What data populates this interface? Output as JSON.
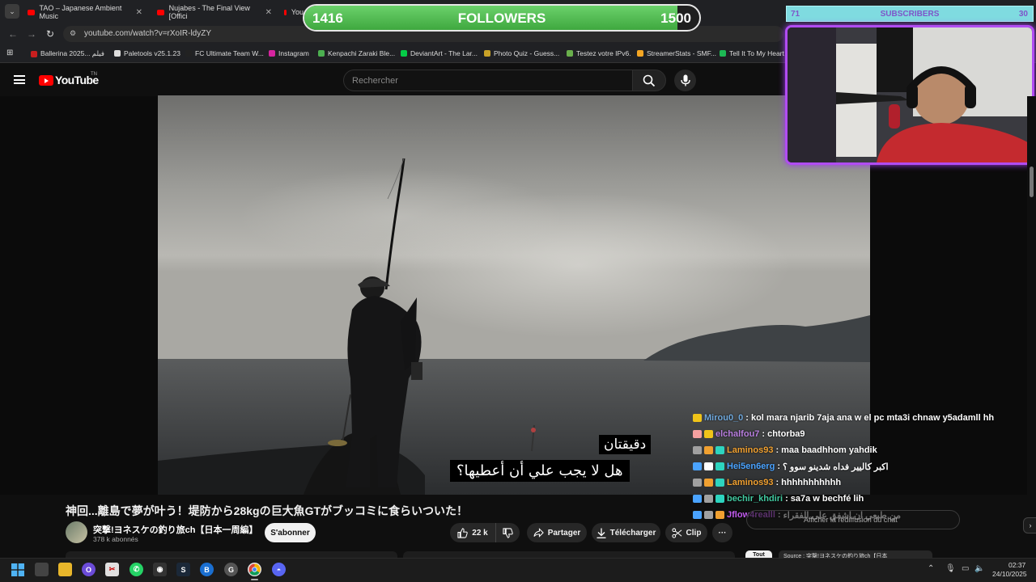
{
  "browser": {
    "tabs": [
      {
        "title": "TAO – Japanese Ambient Music"
      },
      {
        "title": "Nujabes - The Final View [Offici"
      },
      {
        "title": "You"
      }
    ],
    "address": {
      "url": "youtube.com/watch?v=rXoIR-ldyZY"
    },
    "bookmarks": [
      {
        "label": "Ballerina 2025... فيلم",
        "color": "#c81e1e"
      },
      {
        "label": "Paletools v25.1.23",
        "color": "#dddddd"
      },
      {
        "label": "FC Ultimate Team W...",
        "color": "#222222"
      },
      {
        "label": "Instagram",
        "color": "#d6249f"
      },
      {
        "label": "Kenpachi Zaraki Ble...",
        "color": "#4caf50"
      },
      {
        "label": "DeviantArt - The Lar...",
        "color": "#05cc47"
      },
      {
        "label": "Photo Quiz - Guess...",
        "color": "#c9a227"
      },
      {
        "label": "Testez votre IPv6.",
        "color": "#6ab04c"
      },
      {
        "label": "StreamerStats - SMF...",
        "color": "#f5a623"
      },
      {
        "label": "Tell It To My Heart",
        "color": "#1db954"
      }
    ]
  },
  "youtube": {
    "logo_text": "YouTube",
    "logo_tm": "TN",
    "search_placeholder": "Rechercher",
    "video": {
      "subtitle_line1": "دقيقتان",
      "subtitle_line2": "هل لا يجب علي أن أعطيها؟",
      "title": "神回...離島で夢が叶う！堤防から28kgの巨大魚GTがブッコミに食らいついた！",
      "channel": "突撃!ヨネスケの釣り旅ch【日本一周編】",
      "subscribers": "378 k abonnés",
      "subscribe_label": "S'abonner",
      "likes": "22 k",
      "share_label": "Partager",
      "download_label": "Télécharger",
      "clip_label": "Clip",
      "more_label": "···"
    },
    "recommendations": {
      "chip_all": "Tout",
      "chip_next": "Source : 突撃!ヨネスケの釣り旅ch【日本"
    }
  },
  "overlay": {
    "followers": {
      "current": "1416",
      "label": "FOLLOWERS",
      "goal": "1500",
      "progress": 0.944
    },
    "subscribers": {
      "current": "71",
      "label": "SUBSCRIBERS",
      "goal": "30"
    },
    "chat": {
      "input_placeholder": "Afficher la rediffusion du chat",
      "messages": [
        {
          "user": "Mirou0_0",
          "color": "#6fa8dc",
          "text": "kol mara njarib 7aja ana w el pc mta3i chnaw y5adamll hh"
        },
        {
          "user": "elchalfou7",
          "color": "#b97fe0",
          "text": "chtorba9"
        },
        {
          "user": "Laminos93",
          "color": "#f0a030",
          "text": "maa baadhhom yahdik"
        },
        {
          "user": "Hei5en6erg",
          "color": "#4aa3ff",
          "text": "اكبر كاليير فداه شدينو سوو ؟"
        },
        {
          "user": "Laminos93",
          "color": "#f0a030",
          "text": "hhhhhhhhhhh"
        },
        {
          "user": "bechir_khdiri",
          "color": "#41c9a0",
          "text": "sa7a w bechfé lih"
        },
        {
          "user": "Jflow4realll",
          "color": "#c35cf0",
          "text": "من طبعي ان اشفق على الفقراء"
        }
      ]
    }
  },
  "taskbar": {
    "time": "02:37",
    "date": "24/10/2025"
  }
}
